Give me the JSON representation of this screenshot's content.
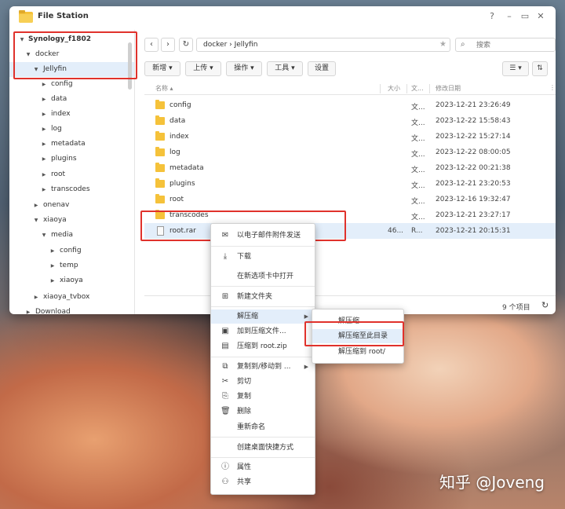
{
  "window": {
    "title": "File Station"
  },
  "sidebar": {
    "items": [
      {
        "label": "Synology_f1802",
        "expanded": true
      },
      {
        "label": "docker",
        "expanded": true
      },
      {
        "label": "Jellyfin",
        "expanded": true,
        "selected": true
      },
      {
        "label": "config"
      },
      {
        "label": "data"
      },
      {
        "label": "index"
      },
      {
        "label": "log"
      },
      {
        "label": "metadata"
      },
      {
        "label": "plugins"
      },
      {
        "label": "root"
      },
      {
        "label": "transcodes"
      },
      {
        "label": "onenav"
      },
      {
        "label": "xiaoya",
        "expanded": true
      },
      {
        "label": "media",
        "expanded": true
      },
      {
        "label": "config"
      },
      {
        "label": "temp"
      },
      {
        "label": "xiaoya"
      },
      {
        "label": "xiaoya_tvbox"
      },
      {
        "label": "Download"
      }
    ]
  },
  "nav": {
    "path": "docker  ›  Jellyfin",
    "search_placeholder": "搜索"
  },
  "toolbar": {
    "new_label": "新增 ▾",
    "upload_label": "上传 ▾",
    "action_label": "操作 ▾",
    "tools_label": "工具 ▾",
    "settings_label": "设置"
  },
  "list": {
    "columns": {
      "name": "名称 ▴",
      "size": "大小",
      "type": "文...",
      "modified": "修改日期"
    },
    "rows": [
      {
        "name": "config",
        "size": "",
        "type": "文...",
        "modified": "2023-12-21 23:26:49",
        "kind": "folder"
      },
      {
        "name": "data",
        "size": "",
        "type": "文...",
        "modified": "2023-12-22 15:58:43",
        "kind": "folder"
      },
      {
        "name": "index",
        "size": "",
        "type": "文...",
        "modified": "2023-12-22 15:27:14",
        "kind": "folder"
      },
      {
        "name": "log",
        "size": "",
        "type": "文...",
        "modified": "2023-12-22 08:00:05",
        "kind": "folder"
      },
      {
        "name": "metadata",
        "size": "",
        "type": "文...",
        "modified": "2023-12-22 00:21:38",
        "kind": "folder"
      },
      {
        "name": "plugins",
        "size": "",
        "type": "文...",
        "modified": "2023-12-21 23:20:53",
        "kind": "folder"
      },
      {
        "name": "root",
        "size": "",
        "type": "文...",
        "modified": "2023-12-16 19:32:47",
        "kind": "folder"
      },
      {
        "name": "transcodes",
        "size": "",
        "type": "文...",
        "modified": "2023-12-21 23:27:17",
        "kind": "folder"
      },
      {
        "name": "root.rar",
        "size": "46...",
        "type": "R...",
        "modified": "2023-12-21 20:15:31",
        "kind": "rar",
        "selected": true
      }
    ],
    "status": "9 个项目"
  },
  "context_menu": {
    "items": [
      {
        "label": "以电子邮件附件发送",
        "icon": "mail-icon"
      },
      {
        "label": "下载",
        "icon": "download-icon"
      },
      {
        "label": "在新选项卡中打开",
        "icon": ""
      },
      {
        "label": "新建文件夹",
        "icon": "new-folder-icon"
      },
      {
        "label": "解压缩",
        "icon": "",
        "submenu": true,
        "hover": true
      },
      {
        "label": "加到压缩文件...",
        "icon": "archive-add-icon"
      },
      {
        "label": "压缩到 root.zip",
        "icon": "archive-icon"
      },
      {
        "label": "复制到/移动到 ...",
        "icon": "copy-move-icon",
        "submenu": true
      },
      {
        "label": "剪切",
        "icon": "cut-icon"
      },
      {
        "label": "复制",
        "icon": "copy-icon"
      },
      {
        "label": "删除",
        "icon": "trash-icon"
      },
      {
        "label": "重新命名",
        "icon": ""
      },
      {
        "label": "创建桌面快捷方式",
        "icon": ""
      },
      {
        "label": "属性",
        "icon": "info-icon"
      },
      {
        "label": "共享",
        "icon": "share-icon"
      }
    ]
  },
  "submenu": {
    "items": [
      {
        "label": "解压缩..."
      },
      {
        "label": "解压缩至此目录",
        "hover": true
      },
      {
        "label": "解压缩到 root/"
      }
    ]
  },
  "watermark": "知乎 @Joveng",
  "colors": {
    "accent": "#1a73d6",
    "highlight": "#e0322c",
    "selection": "#e3eefa",
    "folder": "#f5c23a"
  }
}
